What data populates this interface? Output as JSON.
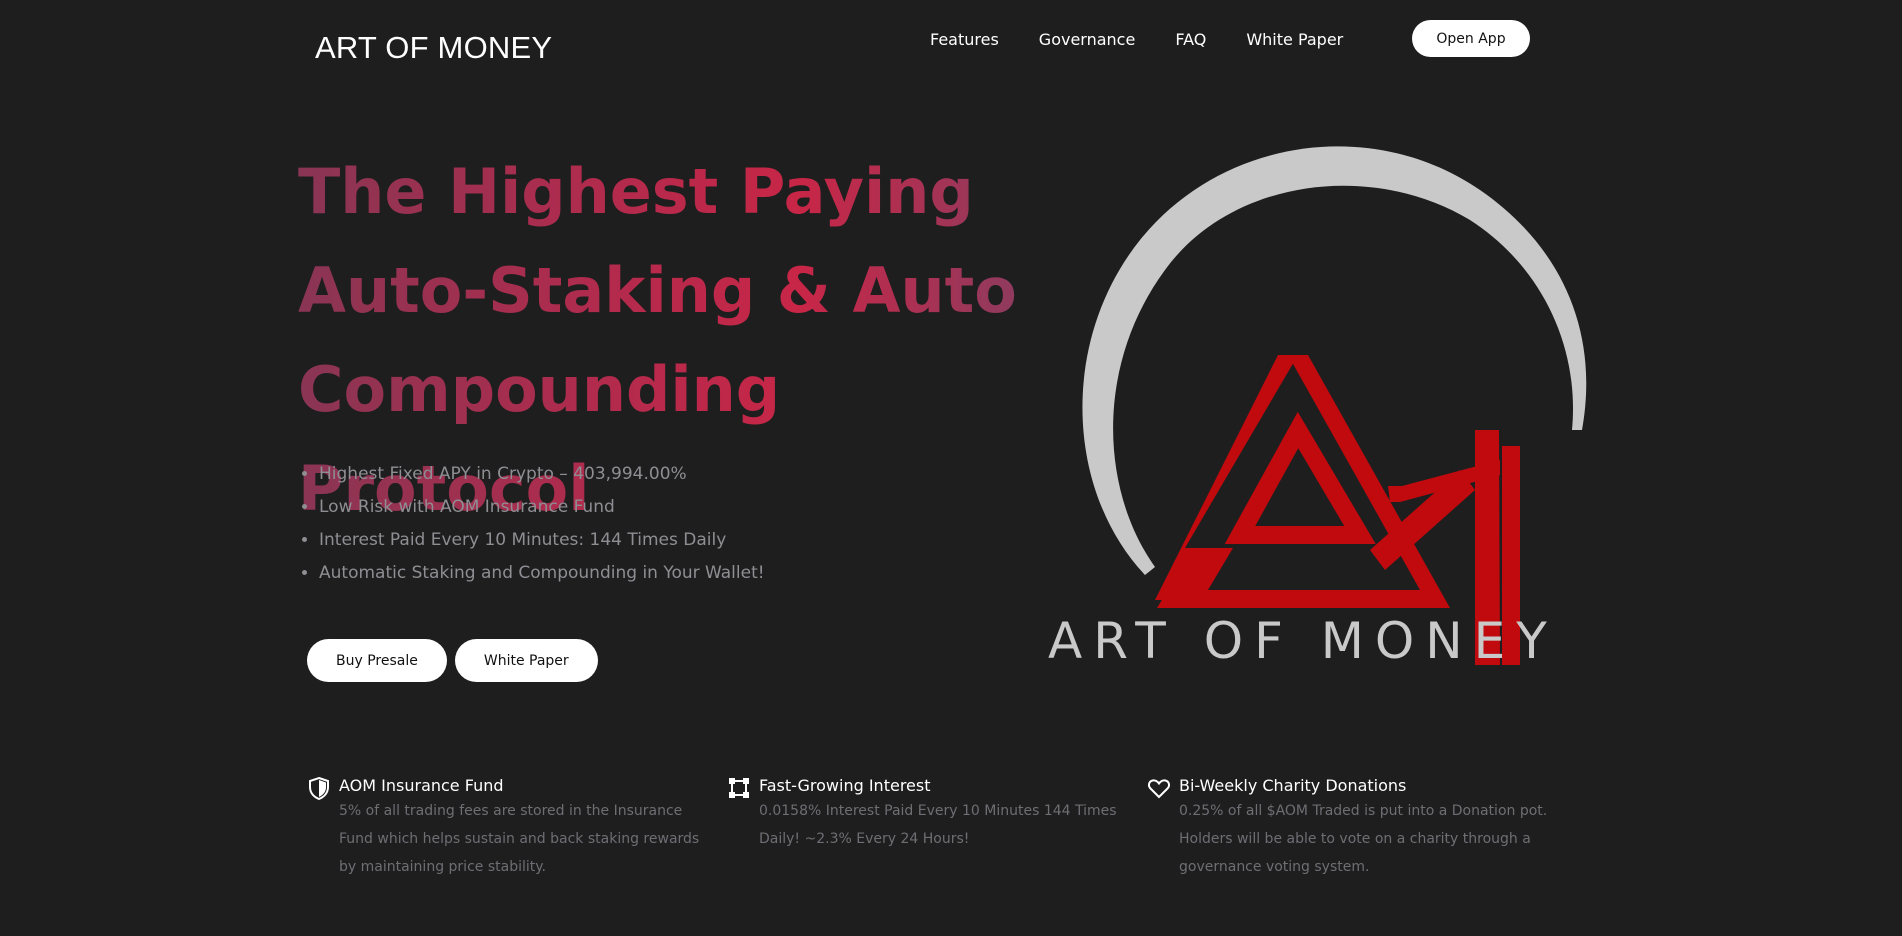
{
  "header": {
    "brand": "ART OF MONEY",
    "nav": [
      "Features",
      "Governance",
      "FAQ",
      "White Paper"
    ],
    "open_app_label": "Open App"
  },
  "hero": {
    "title_lines": [
      "The Highest Paying",
      "Auto-Staking & Auto",
      "Compounding Protocol"
    ],
    "bullets": [
      "Highest Fixed APY in Crypto – 403,994.00%",
      "Low Risk with AOM Insurance Fund",
      "Interest Paid Every 10 Minutes: 144 Times Daily",
      "Automatic Staking and Compounding in Your Wallet!"
    ],
    "buy_presale_label": "Buy Presale",
    "white_paper_label": "White Paper",
    "logo_text": "ART OF MONEY",
    "colors": {
      "title_gradient": [
        "#8a3554",
        "#c82647"
      ],
      "logo_red": "#c00a0e",
      "logo_gray": "#c9c9c9"
    }
  },
  "features": [
    {
      "icon": "shield-icon",
      "title": "AOM Insurance Fund",
      "desc": "5% of all trading fees are stored in the Insurance Fund which helps sustain and back staking rewards by maintaining price stability."
    },
    {
      "icon": "expand-square-icon",
      "title": "Fast-Growing Interest",
      "desc": "0.0158% Interest Paid Every 10 Minutes 144 Times Daily! ~2.3% Every 24 Hours!"
    },
    {
      "icon": "heart-icon",
      "title": "Bi-Weekly Charity Donations",
      "desc": "0.25% of all $AOM Traded is put into a Donation pot. Holders will be able to vote on a charity through a governance voting system."
    }
  ]
}
